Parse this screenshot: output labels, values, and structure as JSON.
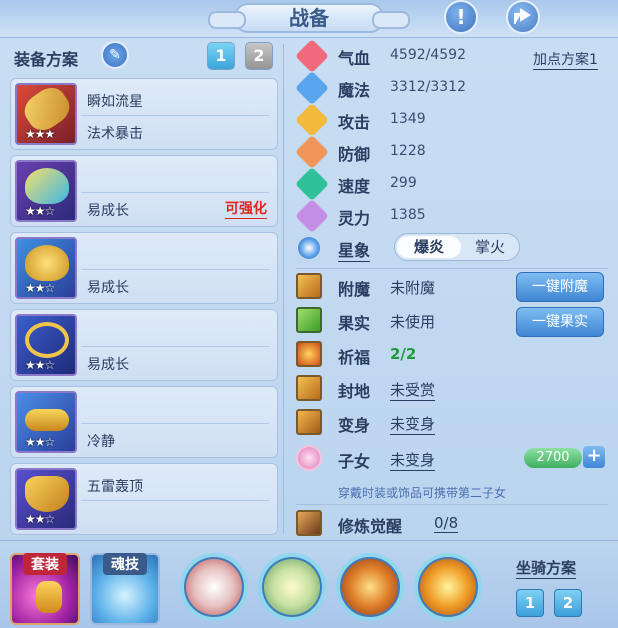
{
  "window": {
    "title": "战备"
  },
  "header": {
    "help_icon_label": "!"
  },
  "equipment": {
    "scheme_label": "装备方案",
    "tabs": [
      "1",
      "2"
    ],
    "items": [
      {
        "line1": "瞬如流星",
        "line2": "法术暴击",
        "stars": "★★★",
        "tag": "",
        "icon": "staff-icon"
      },
      {
        "line1": "",
        "line2": "易成长",
        "stars": "★★☆",
        "tag": "可强化",
        "icon": "helmet-icon"
      },
      {
        "line1": "",
        "line2": "易成长",
        "stars": "★★☆",
        "tag": "",
        "icon": "armor-icon"
      },
      {
        "line1": "",
        "line2": "易成长",
        "stars": "★★☆",
        "tag": "",
        "icon": "necklace-icon"
      },
      {
        "line1": "",
        "line2": "冷静",
        "stars": "★★☆",
        "tag": "",
        "icon": "belt-icon"
      },
      {
        "line1": "五雷轰顶",
        "line2": "",
        "stars": "★★☆",
        "tag": "",
        "icon": "boots-icon"
      }
    ]
  },
  "stats": {
    "items": [
      {
        "label": "气血",
        "value": "4592/4592",
        "color": "#f06a7c"
      },
      {
        "label": "魔法",
        "value": "3312/3312",
        "color": "#5aa6ee"
      },
      {
        "label": "攻击",
        "value": "1349",
        "color": "#f2b93c"
      },
      {
        "label": "防御",
        "value": "1228",
        "color": "#f1955a"
      },
      {
        "label": "速度",
        "value": "299",
        "color": "#2fc29a"
      },
      {
        "label": "灵力",
        "value": "1385",
        "color": "#c58ee6"
      }
    ],
    "plan_link": "加点方案1",
    "constellation_label": "星象",
    "constellation_on": "爆炎",
    "constellation_off": "掌火"
  },
  "status": {
    "items": [
      {
        "label": "附魔",
        "value": "未附魔",
        "style": "plain"
      },
      {
        "label": "果实",
        "value": "未使用",
        "style": "plain"
      },
      {
        "label": "祈福",
        "value": "2/2",
        "style": "green"
      },
      {
        "label": "封地",
        "value": "未受赏",
        "style": "underline"
      },
      {
        "label": "变身",
        "value": "未变身",
        "style": "underline"
      },
      {
        "label": "子女",
        "value": "未变身",
        "style": "underline"
      },
      {
        "label": "修炼觉醒",
        "value": "0/8",
        "style": "underline"
      }
    ],
    "enchant_button": "一键附魔",
    "fruit_button": "一键果实",
    "child_value": "2700",
    "child_plus": "+",
    "note": "穿戴时装或饰品可携带第二子女"
  },
  "bottom": {
    "suit_label": "套装",
    "soul_label": "魂技",
    "mount_label": "坐骑方案",
    "mount_tabs": [
      "1",
      "2"
    ]
  }
}
